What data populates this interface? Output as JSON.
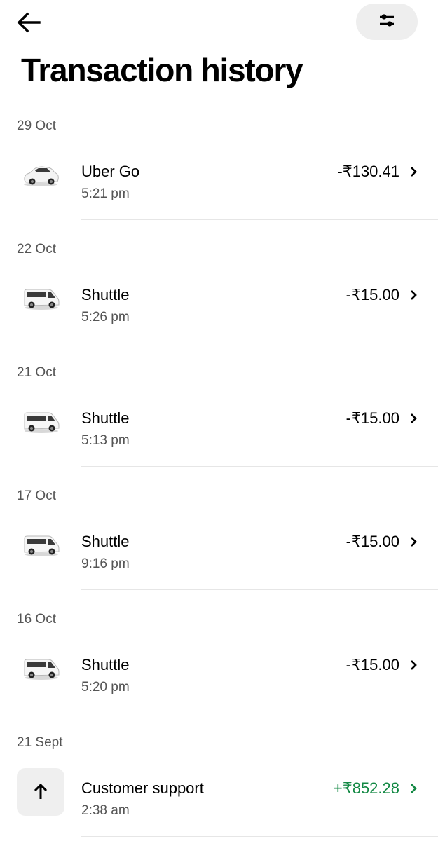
{
  "header": {
    "back_icon": "arrow-left-icon",
    "filter_icon": "sliders-icon",
    "title": "Transaction history"
  },
  "colors": {
    "credit": "#138944",
    "filter_button_bg": "#eeeeee"
  },
  "groups": [
    {
      "date": "29 Oct",
      "transaction": {
        "icon": "car-icon",
        "title": "Uber Go",
        "time": "5:21 pm",
        "amount": "-₹130.41",
        "type": "debit"
      }
    },
    {
      "date": "22 Oct",
      "transaction": {
        "icon": "shuttle-van-icon",
        "title": "Shuttle",
        "time": "5:26 pm",
        "amount": "-₹15.00",
        "type": "debit"
      }
    },
    {
      "date": "21 Oct",
      "transaction": {
        "icon": "shuttle-van-icon",
        "title": "Shuttle",
        "time": "5:13 pm",
        "amount": "-₹15.00",
        "type": "debit"
      }
    },
    {
      "date": "17 Oct",
      "transaction": {
        "icon": "shuttle-van-icon",
        "title": "Shuttle",
        "time": "9:16 pm",
        "amount": "-₹15.00",
        "type": "debit"
      }
    },
    {
      "date": "16 Oct",
      "transaction": {
        "icon": "shuttle-van-icon",
        "title": "Shuttle",
        "time": "5:20 pm",
        "amount": "-₹15.00",
        "type": "debit"
      }
    },
    {
      "date": "21 Sept",
      "transaction": {
        "icon": "arrow-up-icon",
        "title": "Customer support",
        "time": "2:38 am",
        "amount": "+₹852.28",
        "type": "credit"
      }
    }
  ]
}
